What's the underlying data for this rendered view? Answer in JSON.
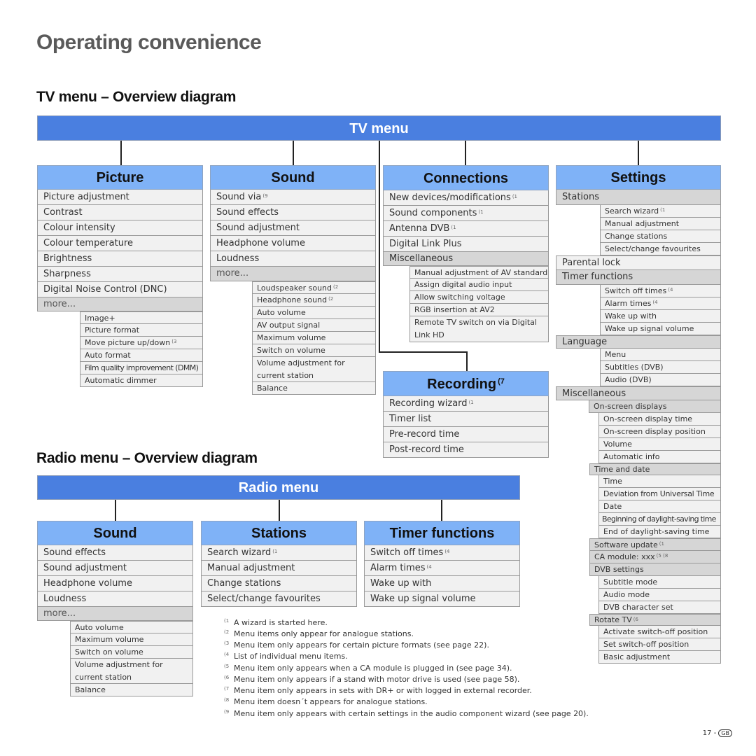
{
  "page_title": "Operating convenience",
  "tv_section": {
    "heading": "TV menu – Overview diagram",
    "root": "TV menu",
    "columns": {
      "picture": {
        "title": "Picture",
        "items": [
          "Picture adjustment",
          "Contrast",
          "Colour intensity",
          "Colour temperature",
          "Brightness",
          "Sharpness",
          "Digital Noise Control (DNC)"
        ],
        "more": "more...",
        "subitems": [
          "Image+",
          "Picture format",
          "Move picture up/down",
          "Auto format",
          "Film quality improvement (DMM)",
          "Automatic dimmer"
        ],
        "subitem_notes": {
          "2": "(3"
        }
      },
      "sound": {
        "title": "Sound",
        "items": [
          "Sound via",
          "Sound effects",
          "Sound adjustment",
          "Headphone volume",
          "Loudness"
        ],
        "item_notes": {
          "0": "(9"
        },
        "more": "more...",
        "subitems": [
          "Loudspeaker sound",
          "Headphone sound",
          "Auto volume",
          "AV output signal",
          "Maximum volume",
          "Switch on volume",
          "Volume adjustment for current station",
          "Balance"
        ],
        "subitem_notes": {
          "0": "(2",
          "1": "(2"
        }
      },
      "connections": {
        "title": "Connections",
        "items": [
          "New devices/modifications",
          "Sound components",
          "Antenna DVB",
          "Digital Link Plus"
        ],
        "item_notes": {
          "0": "(1",
          "1": "(1",
          "2": "(1"
        },
        "misc": "Miscellaneous",
        "subitems": [
          "Manual adjustment of AV standard",
          "Assign digital audio input",
          "Allow switching voltage",
          "RGB insertion at AV2",
          "Remote TV switch on via Digital Link HD"
        ]
      },
      "recording": {
        "title": "Recording",
        "title_note": "(7",
        "items": [
          "Recording wizard",
          "Timer list",
          "Pre-record time",
          "Post-record time"
        ],
        "item_notes": {
          "0": "(1"
        }
      },
      "settings": {
        "title": "Settings",
        "stations": {
          "label": "Stations",
          "items": [
            "Search wizard",
            "Manual adjustment",
            "Change stations",
            "Select/change favourites"
          ],
          "notes": {
            "0": "(1"
          }
        },
        "parental_lock": "Parental lock",
        "timer_functions": {
          "label": "Timer functions",
          "items": [
            "Switch off times",
            "Alarm times",
            "Wake up with",
            "Wake up signal volume"
          ],
          "notes": {
            "0": "(4",
            "1": "(4"
          }
        },
        "language": {
          "label": "Language",
          "items": [
            "Menu",
            "Subtitles (DVB)",
            "Audio (DVB)"
          ]
        },
        "miscellaneous": {
          "label": "Miscellaneous",
          "osd": {
            "label": "On-screen displays",
            "items": [
              "On-screen display time",
              "On-screen display position",
              "Volume",
              "Automatic info"
            ]
          },
          "time_date": {
            "label": "Time and date",
            "items": [
              "Time",
              "Deviation from Universal Time",
              "Date",
              "Beginning of daylight-saving time",
              "End of daylight-saving time"
            ]
          },
          "software_update": "Software update",
          "software_update_note": "(1",
          "ca_module": "CA module: xxx",
          "ca_module_note": "(5 (8",
          "dvb_settings": {
            "label": "DVB settings",
            "items": [
              "Subtitle mode",
              "Audio mode",
              "DVB character set"
            ]
          },
          "rotate_tv": {
            "label": "Rotate TV",
            "note": "(6",
            "items": [
              "Activate switch-off position",
              "Set switch-off position",
              "Basic adjustment"
            ]
          }
        }
      }
    }
  },
  "radio_section": {
    "heading": "Radio menu – Overview diagram",
    "root": "Radio menu",
    "columns": {
      "sound": {
        "title": "Sound",
        "items": [
          "Sound effects",
          "Sound adjustment",
          "Headphone volume",
          "Loudness"
        ],
        "more": "more...",
        "subitems": [
          "Auto volume",
          "Maximum volume",
          "Switch on volume",
          "Volume adjustment for current station",
          "Balance"
        ]
      },
      "stations": {
        "title": "Stations",
        "items": [
          "Search wizard",
          "Manual adjustment",
          "Change stations",
          "Select/change favourites"
        ],
        "item_notes": {
          "0": "(1"
        }
      },
      "timer": {
        "title": "Timer functions",
        "items": [
          "Switch off times",
          "Alarm times",
          "Wake up with",
          "Wake up signal volume"
        ],
        "item_notes": {
          "0": "(4",
          "1": "(4"
        }
      }
    }
  },
  "footnotes": [
    {
      "mark": "(1",
      "text": "A wizard is started here."
    },
    {
      "mark": "(2",
      "text": "Menu items only appear for analogue stations."
    },
    {
      "mark": "(3",
      "text": "Menu item only appears for certain picture formats (see page 22)."
    },
    {
      "mark": "(4",
      "text": "List of individual menu items."
    },
    {
      "mark": "(5",
      "text": "Menu item only appears when a CA module is plugged in (see page 34)."
    },
    {
      "mark": "(6",
      "text": "Menu item only appears if a stand with motor drive is used (see page 58)."
    },
    {
      "mark": "(7",
      "text": "Menu item only appears in sets with DR+ or with logged in external recorder."
    },
    {
      "mark": "(8",
      "text": "Menu item doesn´t appears for analogue stations."
    },
    {
      "mark": "(9",
      "text": "Menu item only appears with certain settings in the audio component wizard (see page 20)."
    }
  ],
  "page_number": "17 -",
  "country_badge": "GB",
  "colors": {
    "bar": "#4a7fe0",
    "header": "#7fb2f7",
    "row": "#f1f1f1",
    "row_grey": "#d6d6d6"
  }
}
